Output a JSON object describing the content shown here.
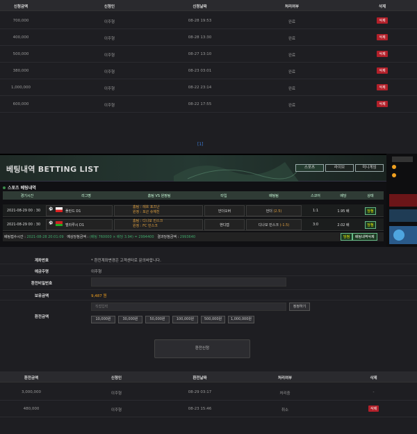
{
  "top_table": {
    "headers": [
      "신청금액",
      "신청인",
      "신청날짜",
      "처리여부",
      "삭제"
    ],
    "rows": [
      {
        "amount": "700,000",
        "name": "이주형",
        "date": "08-28 19:53",
        "status": "완료",
        "delete": "삭제"
      },
      {
        "amount": "400,000",
        "name": "이주형",
        "date": "08-28 13:30",
        "status": "완료",
        "delete": "삭제"
      },
      {
        "amount": "500,000",
        "name": "이주형",
        "date": "08-27 13:10",
        "status": "완료",
        "delete": "삭제"
      },
      {
        "amount": "380,000",
        "name": "이주형",
        "date": "08-23 03:01",
        "status": "완료",
        "delete": "삭제"
      },
      {
        "amount": "1,000,000",
        "name": "이주형",
        "date": "08-22 23:14",
        "status": "완료",
        "delete": "삭제"
      },
      {
        "amount": "600,000",
        "name": "이주형",
        "date": "08-22 17:55",
        "status": "완료",
        "delete": "삭제"
      }
    ],
    "pager": "[1]"
  },
  "betting": {
    "title": "베팅내역 BETTING LIST",
    "tabs": [
      "스포츠",
      "라이브",
      "미니게임"
    ],
    "subtitle": "스포츠 베팅내역",
    "headers": [
      "경기시간",
      "리그명",
      "홈팀 VS 원정팀",
      "타입",
      "배팅팀",
      "스코어",
      "배당",
      "상태"
    ],
    "rows": [
      {
        "time": "2021-08-29 00 : 30",
        "league": "폴란드 D1",
        "home": "홈팀 : 레흐 포즈난",
        "away": "원정 : 포곤 슈체친",
        "type": "언더오버",
        "pick": "언더",
        "pick_line": "(2.5)",
        "score": "1:1",
        "odds": "1.95 배",
        "status": "당첨"
      },
      {
        "time": "2021-08-29 00 : 30",
        "league": "벨라루시 D1",
        "home": "홈팀 : 디나모 민스크",
        "away": "원정 : FC 민스크",
        "type": "핸디캡",
        "pick": "디나모 민스크",
        "pick_line": "(-1.5)",
        "score": "3:0",
        "odds": "2.02 배",
        "status": "당첨"
      }
    ],
    "footer": {
      "bet_time_label": "베팅접수시간 :",
      "bet_time": "2021-08-28 20:01:09",
      "expected_label": "예상당첨금액 :",
      "expected": "(배팅 760000 × 배당 3.94) = 2994400",
      "result_label": "결과당첨금액 :",
      "result": "2993640",
      "win_btn": "당첨",
      "delete_btn": "배팅내역삭제"
    }
  },
  "form": {
    "account_label": "계좌번호",
    "account_value": "* 환전계좌변경은 고객센터로 문의바랍니다.",
    "holder_label": "예금주명",
    "holder_value": "이주형",
    "password_label": "환전비밀번호",
    "balance_label": "보유금액",
    "balance_value": "9,487 원",
    "amount_label": "환전금액",
    "amount_placeholder": "직접입력",
    "reset_btn": "정정하기",
    "quick": [
      "10,000원",
      "30,000원",
      "50,000원",
      "100,000원",
      "500,000원",
      "1,000,000원"
    ],
    "submit": "환전신청"
  },
  "bottom_table": {
    "headers": [
      "환전금액",
      "신청인",
      "환전날짜",
      "처리여부",
      "삭제"
    ],
    "rows": [
      {
        "amount": "3,000,000",
        "name": "이주형",
        "date": "08-29 03:17",
        "status": "처리중",
        "delete": "-"
      },
      {
        "amount": "480,000",
        "name": "이주형",
        "date": "08-23 15:46",
        "status": "취소",
        "delete": "삭제"
      }
    ]
  },
  "colors": {
    "accent_red": "#b3202a",
    "accent_green": "#3fa86b",
    "balance": "#f0a020"
  }
}
